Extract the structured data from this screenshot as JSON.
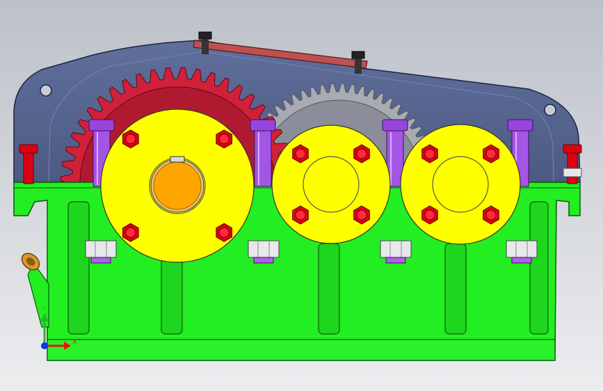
{
  "viewport": {
    "background_top": "#bcc0c8",
    "background_bottom": "#ecedef"
  },
  "model": {
    "housing_base_color": "#22ee22",
    "housing_cover_color": "#3b4e84",
    "bearing_cap_color": "#ffff00",
    "bolt_head_color": "#dd0011",
    "stud_bolt_color": "#9944dd",
    "input_gear_color": "#d0203a",
    "output_gear_color": "#a8aab4",
    "shaft_color": "#ffa500",
    "oil_plug_color": "#d99a28",
    "inspection_cover_color": "#c05050",
    "nut_color": "#e8e8ec"
  },
  "triad": {
    "x_label": "X",
    "y_label": "Y",
    "x_color": "#ee1111",
    "y_color": "#22bb22",
    "z_color": "#1133ee"
  }
}
